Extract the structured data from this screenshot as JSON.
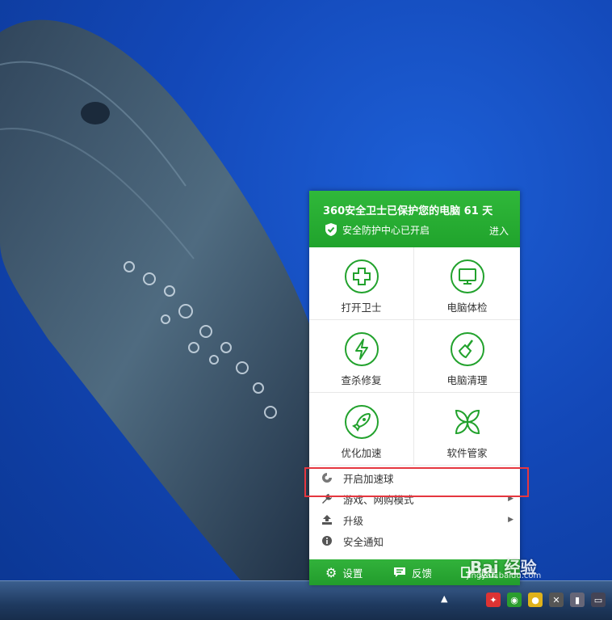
{
  "menu": {
    "title": "360安全卫士已保护您的电脑 61 天",
    "status": "安全防护中心已开启",
    "enter": "进入",
    "grid": [
      {
        "label": "打开卫士",
        "icon": "shield-plus-icon"
      },
      {
        "label": "电脑体检",
        "icon": "monitor-icon"
      },
      {
        "label": "查杀修复",
        "icon": "lightning-icon"
      },
      {
        "label": "电脑清理",
        "icon": "broom-icon"
      },
      {
        "label": "优化加速",
        "icon": "rocket-icon"
      },
      {
        "label": "软件管家",
        "icon": "four-leaf-icon"
      }
    ],
    "list": [
      {
        "label": "开启加速球",
        "icon": "accel-ball-icon"
      },
      {
        "label": "游戏、网购模式",
        "icon": "wrench-icon"
      },
      {
        "label": "升级",
        "icon": "upgrade-icon"
      },
      {
        "label": "安全通知",
        "icon": "info-icon"
      }
    ],
    "footer": [
      {
        "label": "设置",
        "icon": "gear-icon"
      },
      {
        "label": "反馈",
        "icon": "chat-icon"
      },
      {
        "label": "退出",
        "icon": "exit-icon"
      }
    ]
  },
  "watermark": {
    "main": "Bai 经验",
    "sub": "jingyan.baidu.com"
  },
  "colors": {
    "brand_green": "#22a22d",
    "highlight_red": "#e5363f"
  }
}
